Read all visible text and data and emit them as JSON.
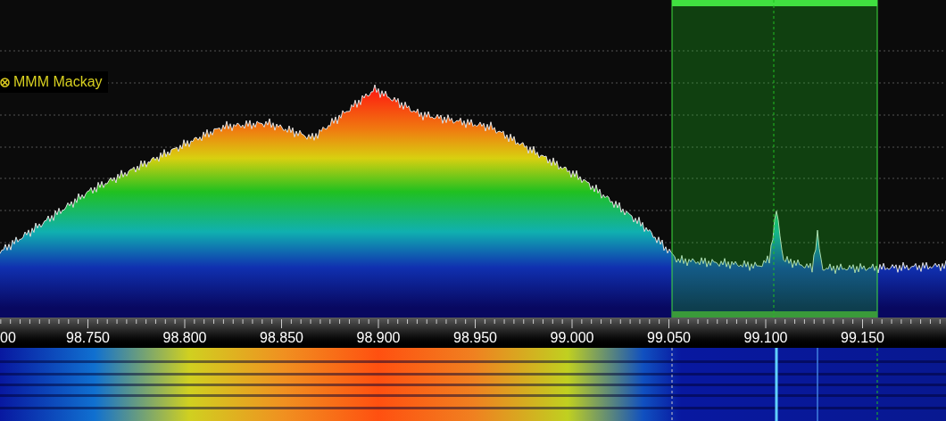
{
  "spectrum": {
    "markers": [
      {
        "label": "MMM Mackay"
      }
    ]
  },
  "frequency_axis": {
    "labels": [
      "00",
      "98.750",
      "98.800",
      "98.850",
      "98.900",
      "98.950",
      "99.000",
      "99.050",
      "99.100",
      "99.150"
    ]
  }
}
